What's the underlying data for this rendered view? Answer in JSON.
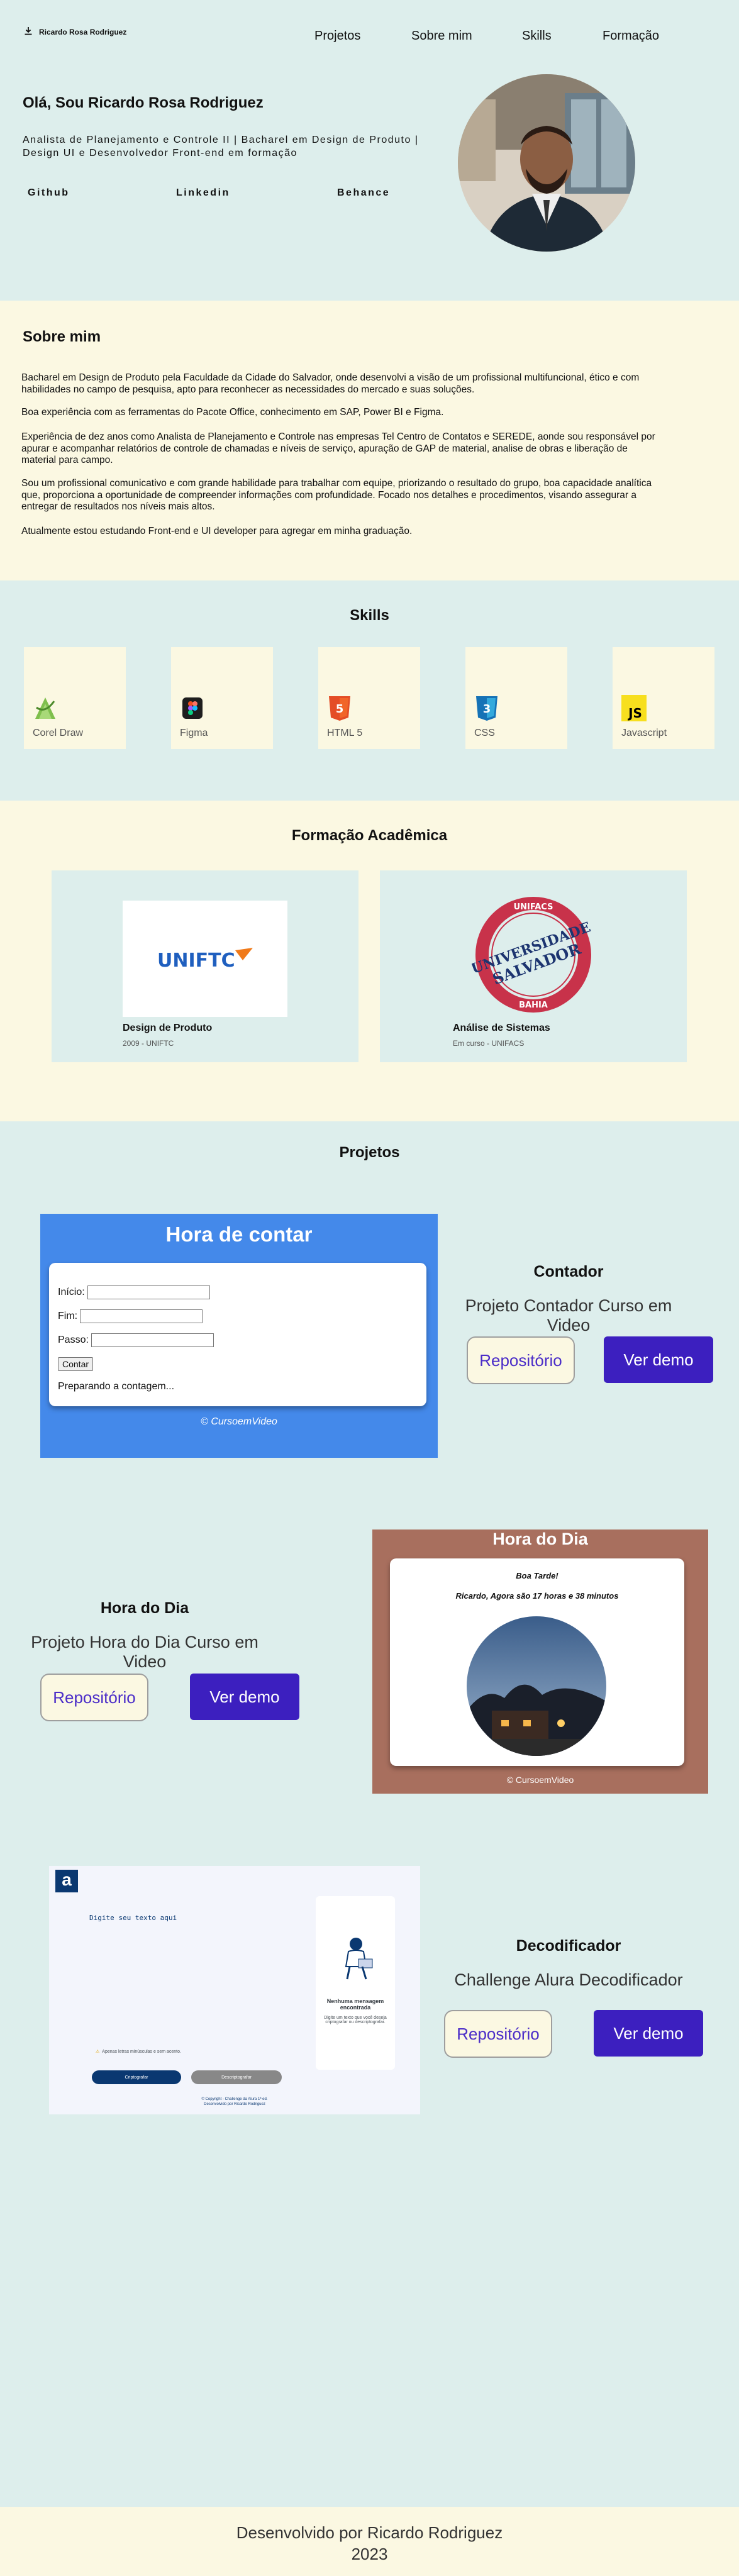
{
  "header": {
    "brand": "Ricardo Rosa Rodriguez",
    "nav": [
      "Projetos",
      "Sobre mim",
      "Skills",
      "Formação"
    ]
  },
  "hero": {
    "title": "Olá, Sou Ricardo Rosa Rodriguez",
    "subtitle_line1": "Analista de Planejamento e Controle II | Bacharel em Design de Produto |",
    "subtitle_line2": "Design UI e Desenvolvedor Front-end em formação",
    "social": [
      "Github",
      "Linkedin",
      "Behance"
    ]
  },
  "sobre": {
    "title": "Sobre mim",
    "paragraphs": [
      "Bacharel em Design de Produto pela Faculdade da Cidade do Salvador, onde desenvolvi a visão de um profissional multifuncional, ético e com habilidades no campo de pesquisa, apto para reconhecer as necessidades do mercado e suas soluções.",
      "Boa experiência com as ferramentas do Pacote Office, conhecimento em SAP, Power BI e Figma.",
      "Experiência de dez anos como Analista de Planejamento e Controle nas empresas Tel Centro de Contatos e SEREDE, aonde sou responsável por apurar e acompanhar relatórios de controle de chamadas e níveis de serviço, apuração de GAP de material, analise de obras e liberação de material para campo.",
      "Sou um profissional comunicativo e com grande habilidade para trabalhar com equipe, priorizando o resultado do grupo, boa capacidade analítica que, proporciona a oportunidade de compreender informações com profundidade. Focado nos detalhes e procedimentos, visando assegurar a entregar de resultados nos níveis mais altos.",
      "Atualmente estou estudando Front-end e UI developer para agregar em minha graduação."
    ]
  },
  "skills": {
    "title": "Skills",
    "items": [
      {
        "label": "Corel Draw",
        "icon": "coreldraw-icon"
      },
      {
        "label": "Figma",
        "icon": "figma-icon"
      },
      {
        "label": "HTML 5",
        "icon": "html5-icon"
      },
      {
        "label": "CSS",
        "icon": "css3-icon"
      },
      {
        "label": "Javascript",
        "icon": "javascript-icon"
      }
    ]
  },
  "formacao": {
    "title": "Formação Acadêmica",
    "items": [
      {
        "logo_text": "UNIFTC",
        "title": "Design de Produto",
        "meta": "2009 - UNIFTC"
      },
      {
        "logo_line1": "UNIVERSIDADE",
        "logo_line2": "SALVADOR",
        "logo_ring_top": "UNIFACS",
        "logo_ring_bottom": "BAHIA",
        "title": "Análise de Sistemas",
        "meta": "Em curso - UNIFACS"
      }
    ]
  },
  "projetos": {
    "title": "Projetos",
    "repo_label": "Repositório",
    "demo_label": "Ver demo",
    "items": [
      {
        "title": "Contador",
        "desc": "Projeto Contador Curso em Video",
        "preview": {
          "heading": "Hora de contar",
          "inicio": "Início:",
          "fim": "Fim:",
          "passo": "Passo:",
          "button": "Contar",
          "status": "Preparando a contagem...",
          "footer": "© CursoemVideo"
        }
      },
      {
        "title": "Hora do Dia",
        "desc": "Projeto Hora do Dia Curso em Video",
        "preview": {
          "heading": "Hora do Dia",
          "greeting": "Boa Tarde!",
          "time": "Ricardo, Agora são 17 horas e 38 minutos",
          "footer": "© CursoemVideo"
        }
      },
      {
        "title": "Decodificador",
        "desc": "Challenge Alura Decodificador",
        "preview": {
          "logo": "a",
          "placeholder": "Digite seu texto aqui",
          "empty_title": "Nenhuma mensagem encontrada",
          "empty_text": "Digite um texto que você deseja criptografar ou descriptografar.",
          "warning": "Apenas letras minúsculas e sem acento.",
          "encrypt": "Criptografar",
          "decrypt": "Descriptografar",
          "copyright": "© Copyright - Challenge da Alura 1ª ed.",
          "credit": "Desenvolvido por Ricardo Rodriguez"
        }
      }
    ]
  },
  "footer": {
    "line1": "Desenvolvido por Ricardo Rodriguez",
    "line2": "2023"
  },
  "colors": {
    "mint": "#ddeeec",
    "cream": "#fbf8e2",
    "accent": "#3c1fbf",
    "contador_blue": "#4489ea",
    "hora_brown": "#a86f5e"
  }
}
